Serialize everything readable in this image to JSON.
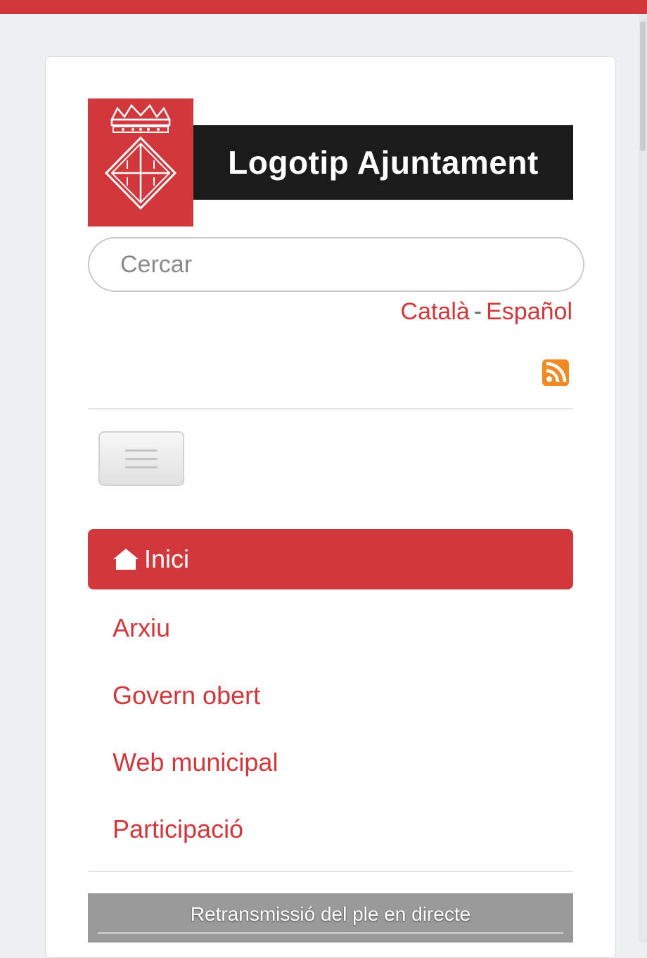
{
  "header": {
    "logo_text": "Logotip Ajuntament"
  },
  "search": {
    "placeholder": "Cercar"
  },
  "languages": {
    "catala": "Català",
    "separator": "-",
    "espanol": "Español"
  },
  "feed": {
    "icon": "rss-icon"
  },
  "nav": {
    "active": {
      "label": "Inici",
      "icon": "home-icon"
    },
    "items": [
      {
        "label": "Arxiu"
      },
      {
        "label": "Govern obert"
      },
      {
        "label": "Web municipal"
      },
      {
        "label": "Participació"
      }
    ]
  },
  "banner": {
    "title": "Retransmissió del ple en directe"
  },
  "colors": {
    "accent": "#d1373b",
    "logo_black": "#1b1b1b",
    "page_bg": "#eef1f4",
    "banner_bg": "#9a9a9a",
    "rss": "#f08a24"
  }
}
